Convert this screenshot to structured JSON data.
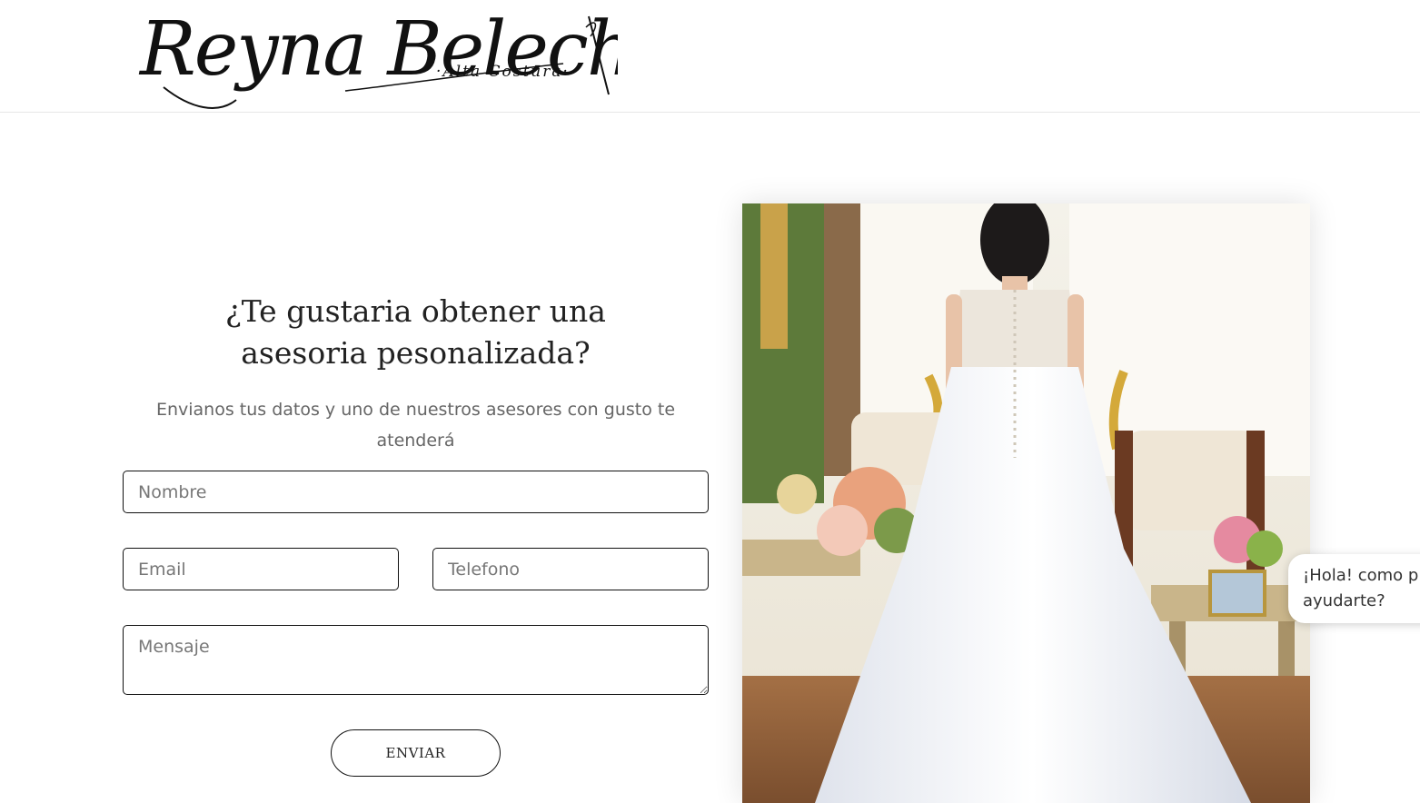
{
  "brand": {
    "logo_name": "Reyna Beleche",
    "logo_tagline": "·Alta Costura·"
  },
  "contact": {
    "heading": "¿Te gustaria obtener una asesoria pesonalizada?",
    "subtext": "Envianos tus datos y uno de nuestros asesores con gusto te atenderá",
    "fields": {
      "name_placeholder": "Nombre",
      "email_placeholder": "Email",
      "phone_placeholder": "Telefono",
      "message_placeholder": "Mensaje"
    },
    "submit_label": "ENVIAR"
  },
  "chat": {
    "line1": "¡Hola! como p",
    "line2": "ayudarte?"
  },
  "photo": {
    "subject": "bride-in-wedding-dress-back-view"
  }
}
